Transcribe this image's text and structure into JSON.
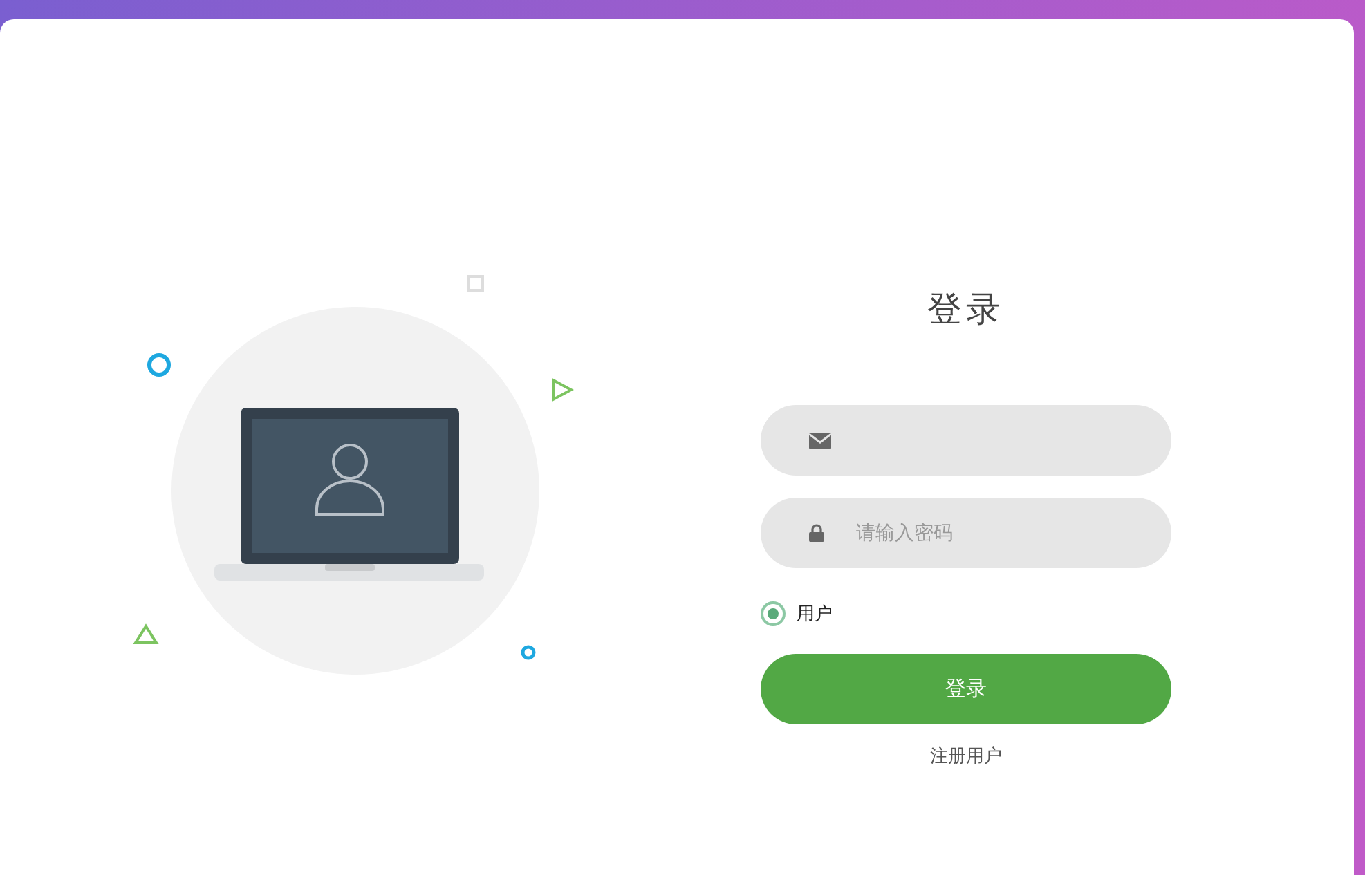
{
  "title": "登录",
  "fields": [
    {
      "kind": "email"
    },
    {
      "kind": "password",
      "placeholder": "请输入密码"
    }
  ],
  "roles": [
    {
      "label": "用户",
      "selected": true
    }
  ],
  "submit": "登录",
  "register_link": "注册用户"
}
